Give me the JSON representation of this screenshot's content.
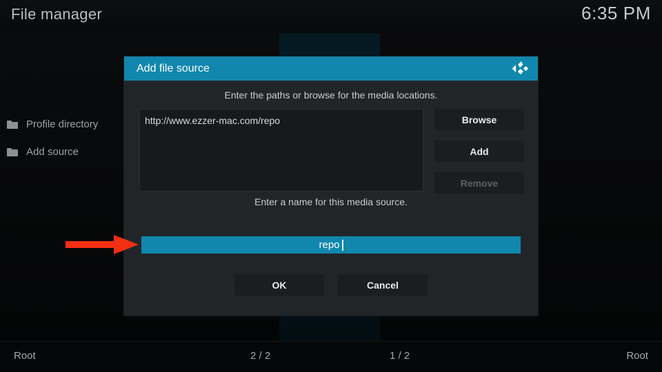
{
  "header": {
    "app_title": "File manager",
    "clock": "6:35 PM"
  },
  "sidebar": {
    "items": [
      {
        "label": "Profile directory",
        "icon": "folder-icon"
      },
      {
        "label": "Add source",
        "icon": "folder-icon"
      }
    ]
  },
  "dialog": {
    "title": "Add file source",
    "logo_icon": "kodi-logo-icon",
    "paths_hint": "Enter the paths or browse for the media locations.",
    "paths": [
      "http://www.ezzer-mac.com/repo"
    ],
    "side_buttons": [
      {
        "label": "Browse",
        "disabled": false
      },
      {
        "label": "Add",
        "disabled": false
      },
      {
        "label": "Remove",
        "disabled": true
      }
    ],
    "name_hint": "Enter a name for this media source.",
    "name_value": "repo",
    "footer_buttons": [
      {
        "label": "OK"
      },
      {
        "label": "Cancel"
      }
    ]
  },
  "annotation": {
    "arrow_icon": "red-arrow-right-icon",
    "arrow_color": "#f22f13"
  },
  "statusbar": {
    "left": "Root",
    "center_left": "2 / 2",
    "center_right": "1 / 2",
    "right": "Root"
  },
  "colors": {
    "accent_teal": "#1187ad",
    "dialog_bg": "#212528",
    "button_bg": "#1a1e21",
    "screen_bg": "#050607"
  }
}
